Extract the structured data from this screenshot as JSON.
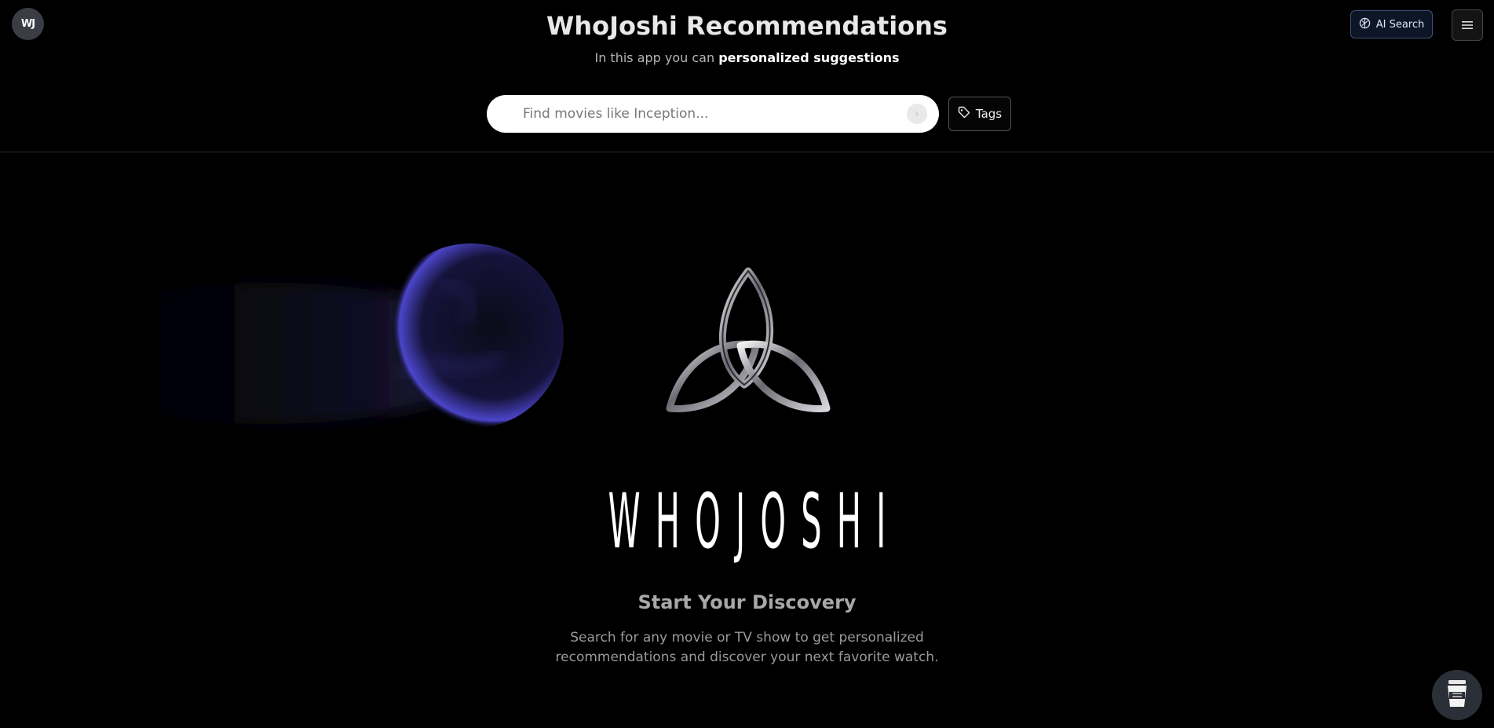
{
  "header": {
    "logo_text": "WJ",
    "title": "WhoJoshi Recommendations",
    "subtitle_prefix": "In this app you can ",
    "subtitle_bold": "personalized suggestions",
    "ai_search_label": "AI Search"
  },
  "search": {
    "placeholder": "Find movies like Inception...",
    "value": "",
    "submit_glyph": "›",
    "tags_label": "Tags"
  },
  "hero": {
    "wordmark": "WHOJOSHI",
    "heading": "Start Your Discovery",
    "description_line1": "Search for any movie or TV show to get personalized",
    "description_line2": "recommendations and discover your next favorite watch."
  },
  "icons": {
    "ai": "brain-circuit-icon",
    "menu": "hamburger-menu-icon",
    "search_submit": "chevron-right-icon",
    "tags": "tag-icon",
    "coffee": "coffee-cup-icon",
    "logo": "triquetra-knot-icon"
  },
  "colors": {
    "background": "#000000",
    "ai_button_border": "#3e5277",
    "nebula_accent": "#4b45c9"
  }
}
